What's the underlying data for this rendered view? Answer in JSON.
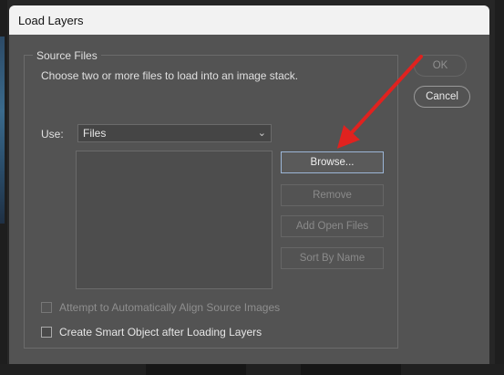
{
  "dialog": {
    "title": "Load Layers",
    "group_title": "Source Files",
    "description": "Choose two or more files to load into an image stack.",
    "use_label": "Use:",
    "use_value": "Files"
  },
  "buttons": {
    "browse": "Browse...",
    "remove": "Remove",
    "add_open_files": "Add Open Files",
    "sort_by_name": "Sort By Name",
    "ok": "OK",
    "cancel": "Cancel"
  },
  "options": {
    "auto_align": {
      "label": "Attempt to Automatically Align Source Images",
      "checked": false,
      "enabled": false
    },
    "smart_object": {
      "label": "Create Smart Object after Loading Layers",
      "checked": false,
      "enabled": true
    }
  },
  "annotation": {
    "arrow_color": "#e0221f"
  }
}
